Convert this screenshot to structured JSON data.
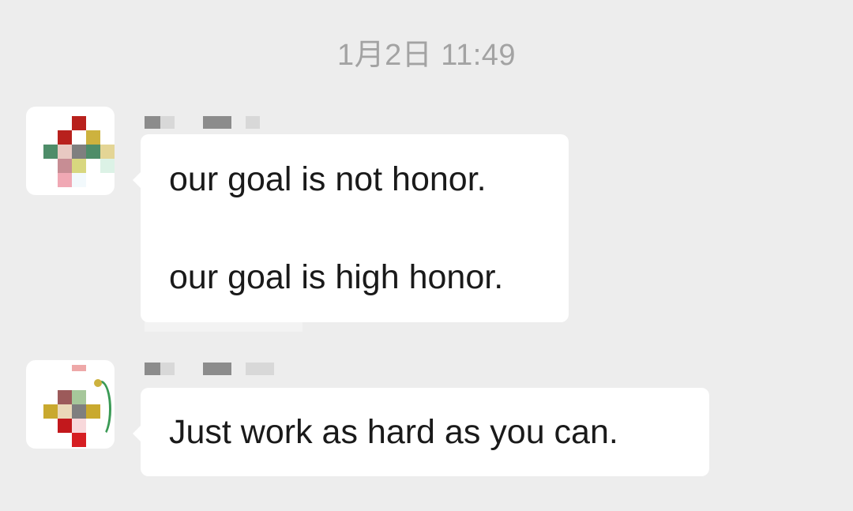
{
  "chat": {
    "timestamp": "1月2日 11:49",
    "messages": [
      {
        "sender_avatar": "pixelated-avatar",
        "lines": [
          "our goal is not honor.",
          "our goal is high honor."
        ]
      },
      {
        "sender_avatar": "pixelated-avatar",
        "lines": [
          "Just work as hard as you can."
        ]
      }
    ]
  },
  "colors": {
    "background": "#ededed",
    "bubble": "#ffffff",
    "timestamp": "#a3a3a3",
    "text": "#1a1a1a"
  }
}
